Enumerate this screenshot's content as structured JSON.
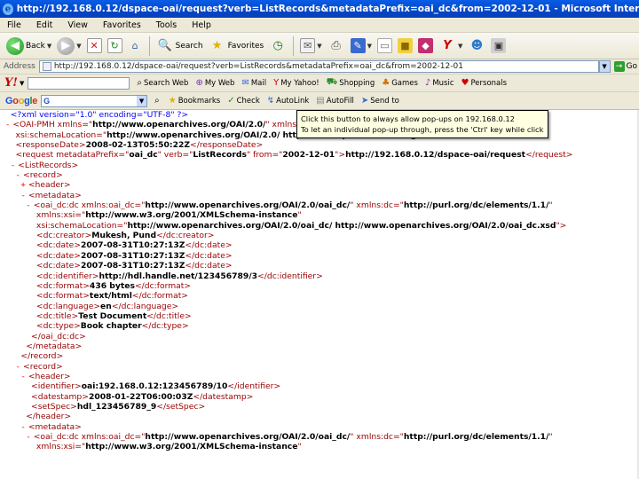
{
  "window": {
    "title": "http://192.168.0.12/dspace-oai/request?verb=ListRecords&metadataPrefix=oai_dc&from=2002-12-01 - Microsoft Internet Explorer",
    "logo_glyph": "e"
  },
  "menu": [
    "File",
    "Edit",
    "View",
    "Favorites",
    "Tools",
    "Help"
  ],
  "toolbar": {
    "back_label": "Back",
    "search_label": "Search",
    "favorites_label": "Favorites"
  },
  "address": {
    "label": "Address",
    "value": "http://192.168.0.12/dspace-oai/request?verb=ListRecords&metadataPrefix=oai_dc&from=2002-12-01",
    "go_label": "Go"
  },
  "yahoo": {
    "logo": "Y!",
    "items": [
      "Search Web",
      "My Web",
      "Mail",
      "My Yahoo!",
      "Shopping",
      "Games",
      "Music",
      "Personals"
    ]
  },
  "google": {
    "items": [
      "Bookmarks",
      "Check",
      "AutoLink",
      "AutoFill",
      "Send to"
    ]
  },
  "popup": {
    "line1": "Click this button to always allow pop-ups on 192.168.0.12",
    "line2": "To let an individual pop-up through, press the 'Ctrl' key while clicking on a link."
  },
  "xml": {
    "pi": "<?xml version=\"1.0\" encoding=\"UTF-8\" ?>",
    "oai_pmh_ns": "http://www.openarchives.org/OAI/2.0/",
    "schema_location": "http://www.openarchives.org/OAI/2.0/ http://www.openarchives.org/OAI/2.0/OAI-PMH.xsd",
    "response_date": "2008-02-13T05:50:22Z",
    "request_prefix": "oai_dc",
    "request_verb": "ListRecords",
    "request_from": "2002-12-01",
    "request_url": "http://192.168.0.12/dspace-oai/request",
    "oai_dc_ns": "http://www.openarchives.org/OAI/2.0/oai_dc/",
    "dc_ns": "http://purl.org/dc/elements/1.1/",
    "xsi_ns": "http://www.w3.org/2001/XMLSchema-instance",
    "oai_dc_schema": "http://www.openarchives.org/OAI/2.0/oai_dc/ http://www.openarchives.org/OAI/2.0/oai_dc.xsd",
    "record1": {
      "creator": "Mukesh, Pund",
      "date1": "2007-08-31T10:27:13Z",
      "date2": "2007-08-31T10:27:13Z",
      "date3": "2007-08-31T10:27:13Z",
      "identifier": "http://hdl.handle.net/123456789/3",
      "format1": "436 bytes",
      "format2": "text/html",
      "language": "en",
      "title": "Test Document",
      "type": "Book chapter"
    },
    "record2": {
      "identifier": "oai:192.168.0.12:123456789/10",
      "datestamp": "2008-01-22T06:00:03Z",
      "setspec": "hdl_123456789_9"
    }
  }
}
